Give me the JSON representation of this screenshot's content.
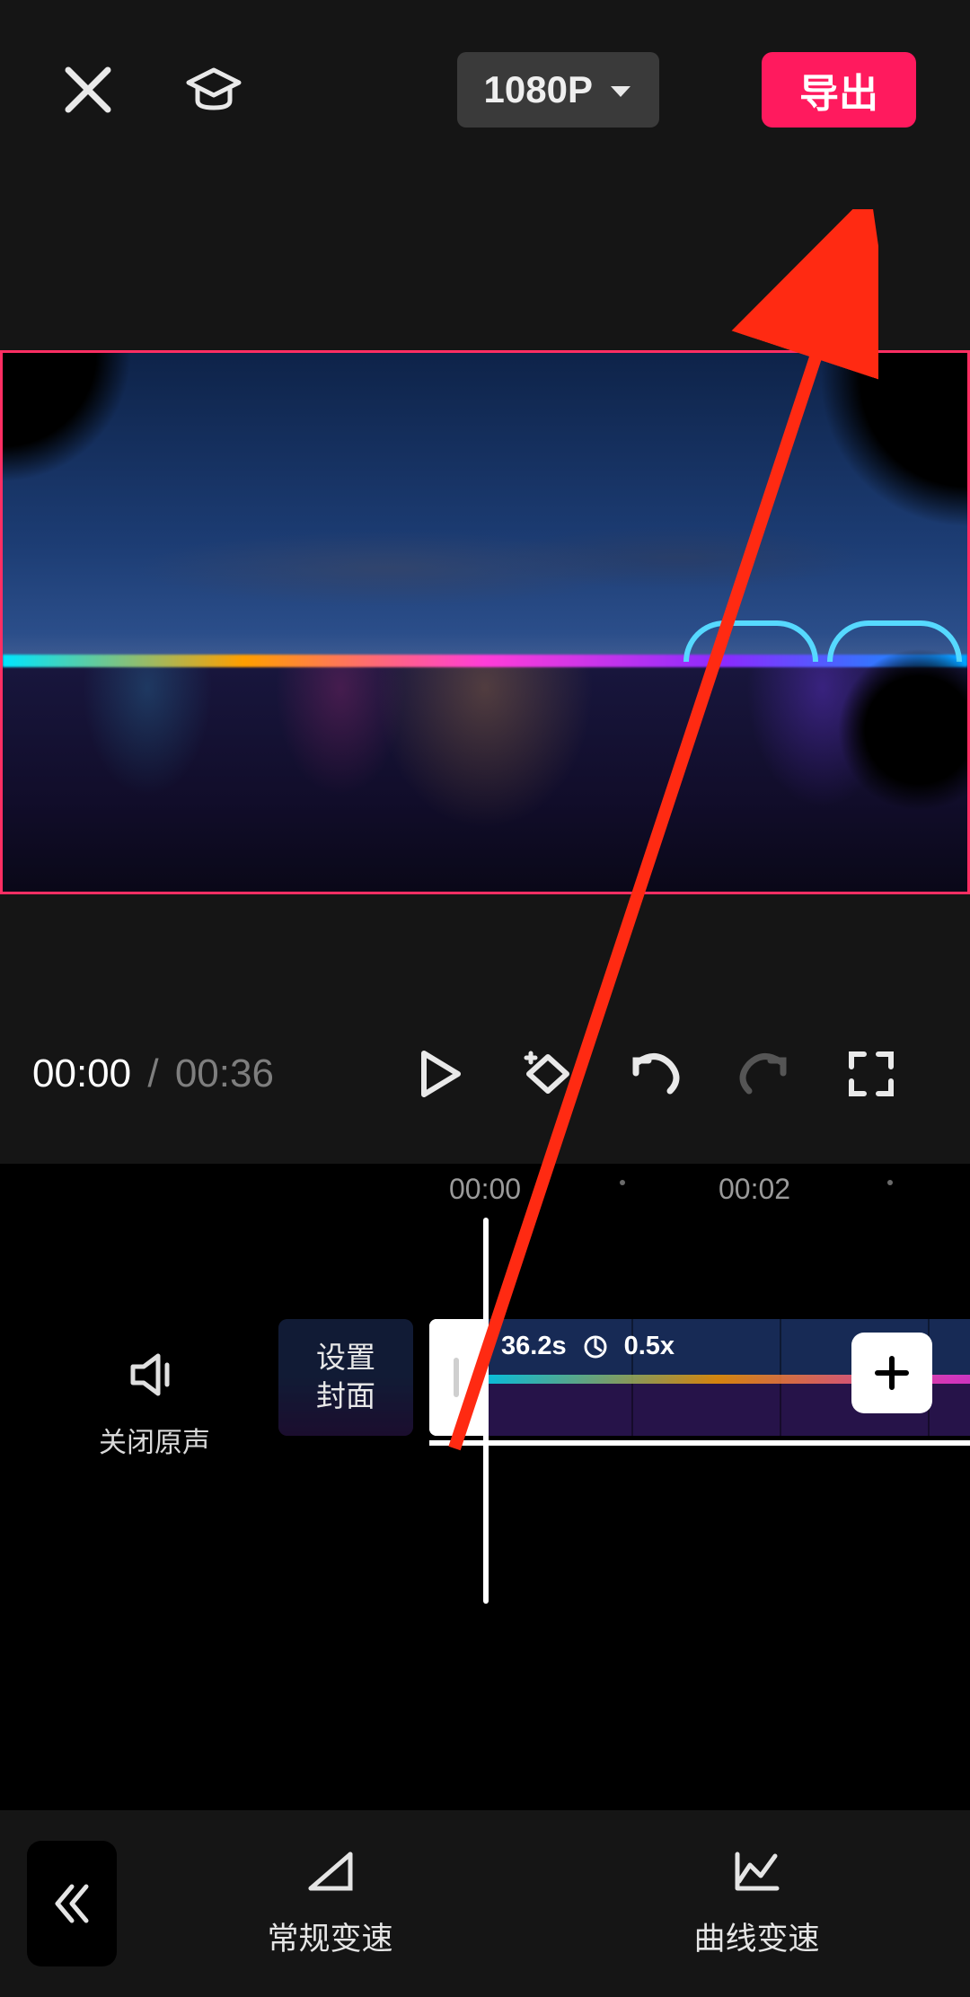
{
  "header": {
    "resolution_label": "1080P",
    "export_label": "导出"
  },
  "player": {
    "current_time": "00:00",
    "separator": "/",
    "total_time": "00:36"
  },
  "ruler": {
    "tick1": "00:00",
    "tick2": "00:02"
  },
  "timeline": {
    "mute_label": "关闭原声",
    "cover_label": "设置\n封面",
    "clip_duration": "36.2s",
    "clip_speed": "0.5x"
  },
  "bottom": {
    "tool1_label": "常规变速",
    "tool2_label": "曲线变速"
  },
  "colors": {
    "accent": "#ff1a5e",
    "annotation": "#ff2a12"
  }
}
